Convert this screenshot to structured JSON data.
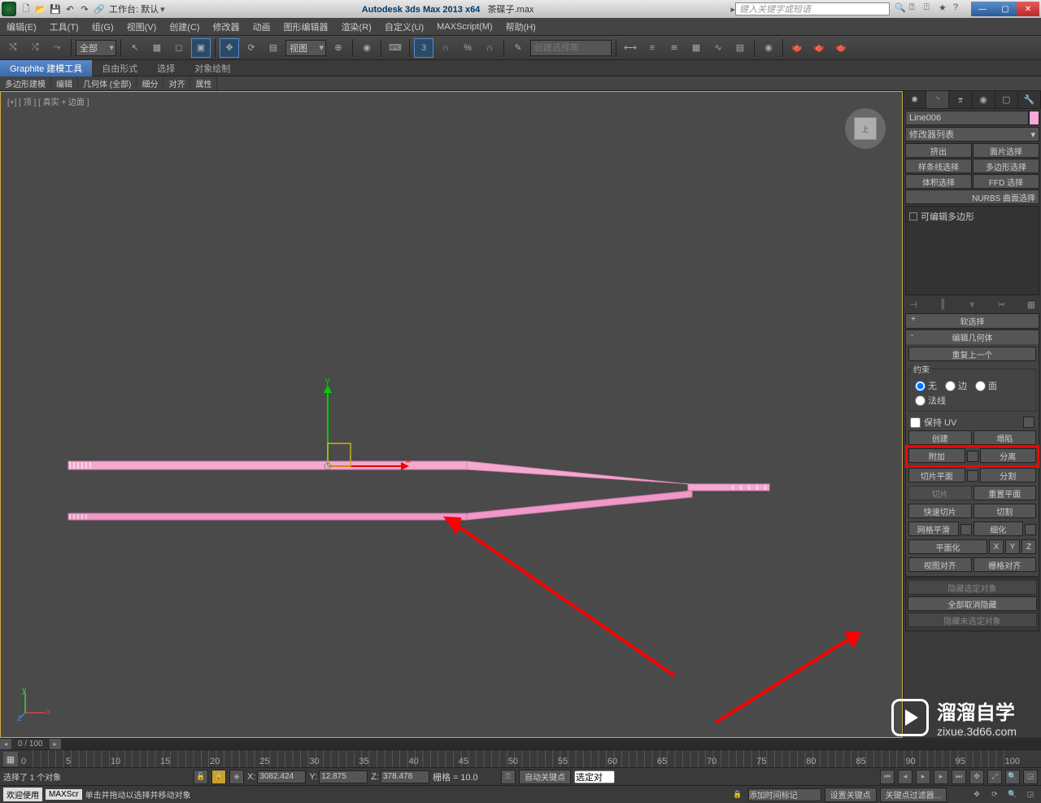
{
  "title": {
    "app": "Autodesk 3ds Max  2013 x64",
    "file": "茶碟子.max",
    "workspace": "工作台: 默认",
    "search_placeholder": "键入关键字或短语"
  },
  "menu": [
    "编辑(E)",
    "工具(T)",
    "组(G)",
    "视图(V)",
    "创建(C)",
    "修改器",
    "动画",
    "图形编辑器",
    "渲染(R)",
    "自定义(U)",
    "MAXScript(M)",
    "帮助(H)"
  ],
  "toolbar": {
    "filter": "全部",
    "view": "视图",
    "create_set": "创建选择集"
  },
  "ribbon": {
    "tabs": [
      "Graphite 建模工具",
      "自由形式",
      "选择",
      "对象绘制"
    ],
    "sub": [
      "多边形建模",
      "编辑",
      "几何体 (全部)",
      "细分",
      "对齐",
      "属性"
    ]
  },
  "viewport": {
    "label": "[+] [ 顶 ] [ 真实 + 边面 ]",
    "cube": "上"
  },
  "scroll": {
    "counter": "0 / 100"
  },
  "timeline": {
    "ticks": [
      "0",
      "5",
      "10",
      "15",
      "20",
      "25",
      "30",
      "35",
      "40",
      "45",
      "50",
      "55",
      "60",
      "65",
      "70",
      "75",
      "80",
      "85",
      "90",
      "95",
      "100"
    ]
  },
  "status": {
    "sel": "选择了 1 个对象",
    "x_lbl": "X:",
    "x": "3082.424",
    "y_lbl": "Y:",
    "y": "12.875",
    "z_lbl": "Z:",
    "z": "378.478",
    "grid_lbl": "栅格 =",
    "grid": "10.0",
    "autokey": "自动关键点",
    "selset": "选定对",
    "prompt": "单击并拖动以选择并移动对象",
    "addtime": "添加时间标记",
    "setkey": "设置关键点",
    "keyfilter": "关键点过滤器...",
    "welcome": "欢迎使用",
    "script": "MAXScr"
  },
  "panel": {
    "name": "Line006",
    "modlist": "修改器列表",
    "buttons": {
      "extrude": "挤出",
      "face_sel": "面片选择",
      "spline_sel": "样条线选择",
      "poly_sel": "多边形选择",
      "vol_sel": "体积选择",
      "ffd_sel": "FFD 选择",
      "nurbs": "NURBS 曲面选择"
    },
    "stack_item": "可编辑多边形",
    "rollouts": {
      "soft": "软选择",
      "editgeo": "编辑几何体",
      "repeat": "重复上一个",
      "constraint_title": "约束",
      "constraints": {
        "none": "无",
        "edge": "边",
        "face": "面",
        "normal": "法线"
      },
      "preserve_uv": "保持 UV",
      "create": "创建",
      "collapse": "塌陷",
      "attach": "附加",
      "detach": "分离",
      "slice_plane": "切片平面",
      "split": "分割",
      "slice": "切片",
      "reset_plane": "重置平面",
      "quick_slice": "快速切片",
      "cut": "切割",
      "msmooth": "网格平滑",
      "tess": "细化",
      "planarize": "平面化",
      "x": "X",
      "y": "Y",
      "z": "Z",
      "view_align": "视图对齐",
      "grid_align": "栅格对齐",
      "hide_sel": "隐藏选定对象",
      "unhide_all": "全部取消隐藏",
      "hide_unsel": "隐藏未选定对象"
    }
  },
  "watermark": {
    "brand": "溜溜自学",
    "url": "zixue.3d66.com"
  }
}
